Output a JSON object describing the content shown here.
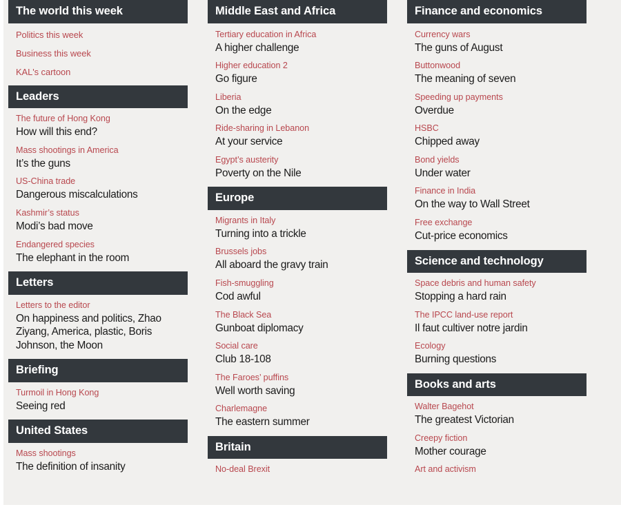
{
  "theme": {
    "page_background": "#f1f0ee",
    "header_background": "#33383d",
    "header_text": "#ffffff",
    "flytitle_color": "#b8474e",
    "headline_color": "#1a1a1a"
  },
  "columns": [
    {
      "id": "column-left",
      "sections": [
        {
          "title": "The world this week",
          "links": [
            "Politics this week",
            "Business this week",
            "KAL's cartoon"
          ],
          "articles": []
        },
        {
          "title": "Leaders",
          "links": [],
          "articles": [
            {
              "flytitle": "The future of Hong Kong",
              "headline": "How will this end?"
            },
            {
              "flytitle": "Mass shootings in America",
              "headline": "It’s the guns"
            },
            {
              "flytitle": "US-China trade",
              "headline": "Dangerous miscalculations"
            },
            {
              "flytitle": "Kashmir’s status",
              "headline": "Modi’s bad move"
            },
            {
              "flytitle": "Endangered species",
              "headline": "The elephant in the room"
            }
          ]
        },
        {
          "title": "Letters",
          "links": [],
          "articles": [
            {
              "flytitle": "Letters to the editor",
              "headline": "On happiness and politics, Zhao Ziyang, America, plastic, Boris Johnson, the Moon"
            }
          ]
        },
        {
          "title": "Briefing",
          "links": [],
          "articles": [
            {
              "flytitle": "Turmoil in Hong Kong",
              "headline": "Seeing red"
            }
          ]
        },
        {
          "title": "United States",
          "links": [],
          "articles": [
            {
              "flytitle": "Mass shootings",
              "headline": "The definition of insanity"
            }
          ]
        }
      ]
    },
    {
      "id": "column-middle",
      "sections": [
        {
          "title": "Middle East and Africa",
          "links": [],
          "articles": [
            {
              "flytitle": "Tertiary education in Africa",
              "headline": "A higher challenge"
            },
            {
              "flytitle": "Higher education 2",
              "headline": "Go figure"
            },
            {
              "flytitle": "Liberia",
              "headline": "On the edge"
            },
            {
              "flytitle": "Ride-sharing in Lebanon",
              "headline": "At your service"
            },
            {
              "flytitle": "Egypt’s austerity",
              "headline": "Poverty on the Nile"
            }
          ]
        },
        {
          "title": "Europe",
          "links": [],
          "articles": [
            {
              "flytitle": "Migrants in Italy",
              "headline": "Turning into a trickle"
            },
            {
              "flytitle": "Brussels jobs",
              "headline": "All aboard the gravy train"
            },
            {
              "flytitle": "Fish-smuggling",
              "headline": "Cod awful"
            },
            {
              "flytitle": "The Black Sea",
              "headline": "Gunboat diplomacy"
            },
            {
              "flytitle": "Social care",
              "headline": "Club 18-108"
            },
            {
              "flytitle": "The Faroes’ puffins",
              "headline": "Well worth saving"
            },
            {
              "flytitle": "Charlemagne",
              "headline": "The eastern summer"
            }
          ]
        },
        {
          "title": "Britain",
          "links": [],
          "articles": [
            {
              "flytitle": "No-deal Brexit",
              "headline": ""
            }
          ]
        }
      ]
    },
    {
      "id": "column-right",
      "sections": [
        {
          "title": "Finance and economics",
          "links": [],
          "articles": [
            {
              "flytitle": "Currency wars",
              "headline": "The guns of August"
            },
            {
              "flytitle": "Buttonwood",
              "headline": "The meaning of seven"
            },
            {
              "flytitle": "Speeding up payments",
              "headline": "Overdue"
            },
            {
              "flytitle": "HSBC",
              "headline": "Chipped away"
            },
            {
              "flytitle": "Bond yields",
              "headline": "Under water"
            },
            {
              "flytitle": "Finance in India",
              "headline": "On the way to Wall Street"
            },
            {
              "flytitle": "Free exchange",
              "headline": "Cut-price economics"
            }
          ]
        },
        {
          "title": "Science and technology",
          "links": [],
          "articles": [
            {
              "flytitle": "Space debris and human safety",
              "headline": "Stopping a hard rain"
            },
            {
              "flytitle": "The IPCC land-use report",
              "headline": "Il faut cultiver notre jardin"
            },
            {
              "flytitle": "Ecology",
              "headline": "Burning questions"
            }
          ]
        },
        {
          "title": "Books and arts",
          "links": [],
          "articles": [
            {
              "flytitle": "Walter Bagehot",
              "headline": "The greatest Victorian"
            },
            {
              "flytitle": "Creepy fiction",
              "headline": "Mother courage"
            },
            {
              "flytitle": "Art and activism",
              "headline": ""
            }
          ]
        }
      ]
    }
  ]
}
